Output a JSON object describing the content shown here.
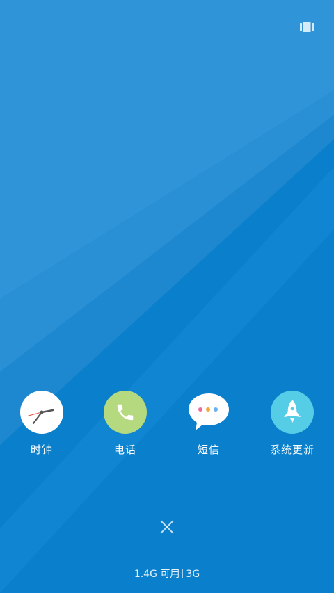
{
  "apps": [
    {
      "label": "时钟",
      "icon": "clock-icon"
    },
    {
      "label": "电话",
      "icon": "phone-icon"
    },
    {
      "label": "短信",
      "icon": "message-icon"
    },
    {
      "label": "系统更新",
      "icon": "rocket-icon"
    }
  ],
  "status": {
    "memory": "1.4G 可用",
    "network": "3G"
  },
  "icons": {
    "top_right": "multi-window-icon",
    "close": "close-icon"
  },
  "colors": {
    "background": "#0a7fcb",
    "phone_icon_bg": "#b5d97f",
    "rocket_icon_bg": "#56cde6",
    "message_dot_pink": "#f06aa0",
    "message_dot_orange": "#f7a63a",
    "message_dot_blue": "#6ab0f0"
  }
}
